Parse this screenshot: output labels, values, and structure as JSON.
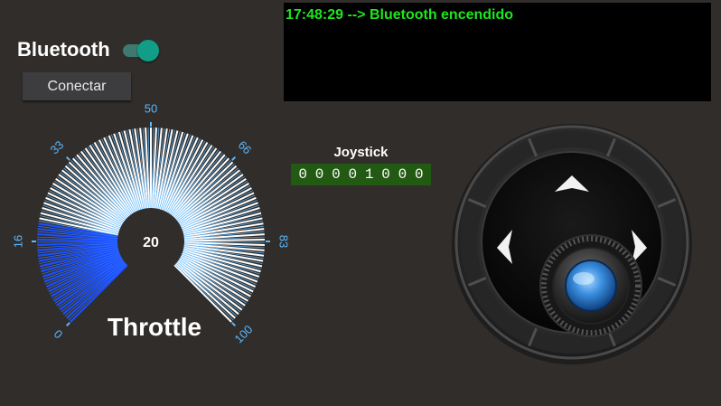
{
  "bluetooth": {
    "label": "Bluetooth",
    "enabled": true
  },
  "connect_button": {
    "label": "Conectar"
  },
  "log": {
    "text": "17:48:29 --> Bluetooth encendido"
  },
  "joystick": {
    "label": "Joystick",
    "bits": [
      "0",
      "0",
      "0",
      "0",
      "1",
      "0",
      "0",
      "0"
    ]
  },
  "throttle": {
    "label": "Throttle",
    "value": "20",
    "value_number": 20,
    "min": 0,
    "max": 100,
    "ticks": [
      "0",
      "16",
      "33",
      "50",
      "66",
      "83",
      "100"
    ]
  },
  "colors": {
    "accent": "#119d86",
    "log_text": "#1ee61e",
    "bits_bg": "#225a14",
    "gauge_fill": "#1a4fff",
    "gauge_line": "#5cb8ff"
  },
  "dpad": {
    "arrows": [
      "arrow-up-icon",
      "arrow-left-icon",
      "arrow-right-icon"
    ],
    "knob": "joystick-knob"
  }
}
